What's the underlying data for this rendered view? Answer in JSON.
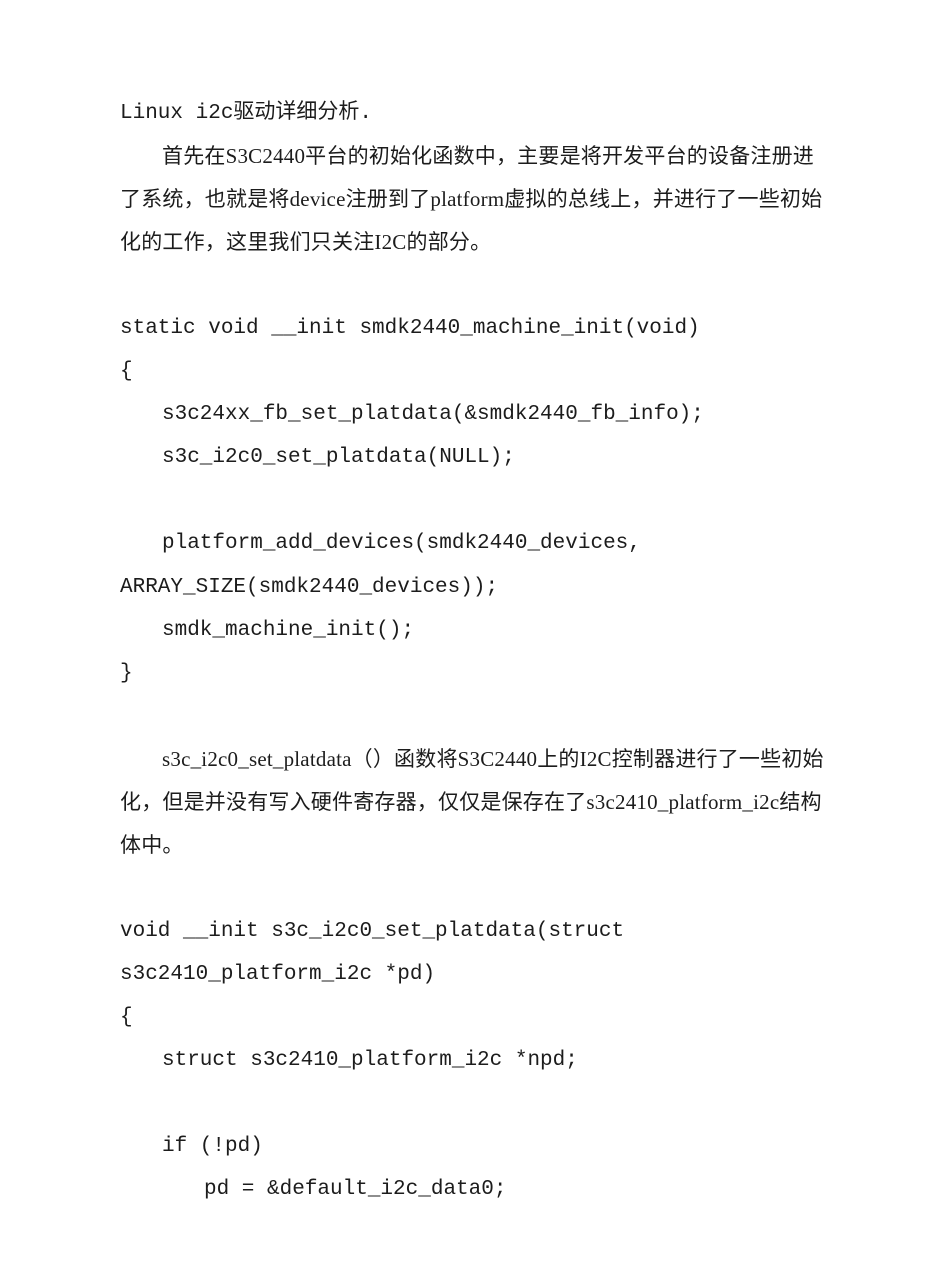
{
  "lines": [
    {
      "cls": "mono",
      "text": "Linux i2c驱动详细分析."
    },
    {
      "cls": "indent",
      "text": "首先在S3C2440平台的初始化函数中，主要是将开发平台的设备注册进了系统，也就是将device注册到了platform虚拟的总线上，并进行了一些初始化的工作，这里我们只关注I2C的部分。"
    },
    {
      "cls": "blank",
      "text": ""
    },
    {
      "cls": "mono",
      "text": "static void __init smdk2440_machine_init(void)"
    },
    {
      "cls": "mono",
      "text": "{"
    },
    {
      "cls": "mono code-indent-1",
      "text": "s3c24xx_fb_set_platdata(&smdk2440_fb_info);"
    },
    {
      "cls": "mono code-indent-1",
      "text": "s3c_i2c0_set_platdata(NULL);"
    },
    {
      "cls": "blank",
      "text": ""
    },
    {
      "cls": "mono code-indent-1",
      "text": "platform_add_devices(smdk2440_devices,"
    },
    {
      "cls": "mono",
      "text": "ARRAY_SIZE(smdk2440_devices));"
    },
    {
      "cls": "mono code-indent-1",
      "text": "smdk_machine_init();"
    },
    {
      "cls": "mono",
      "text": "}"
    },
    {
      "cls": "blank",
      "text": ""
    },
    {
      "cls": "indent",
      "text": "s3c_i2c0_set_platdata（）函数将S3C2440上的I2C控制器进行了一些初始化，但是并没有写入硬件寄存器，仅仅是保存在了s3c2410_platform_i2c结构体中。"
    },
    {
      "cls": "blank",
      "text": ""
    },
    {
      "cls": "mono",
      "text": "void __init s3c_i2c0_set_platdata(struct s3c2410_platform_i2c *pd)"
    },
    {
      "cls": "mono",
      "text": "{"
    },
    {
      "cls": "mono code-indent-1",
      "text": "struct s3c2410_platform_i2c *npd;"
    },
    {
      "cls": "blank",
      "text": ""
    },
    {
      "cls": "mono code-indent-1",
      "text": "if (!pd)"
    },
    {
      "cls": "mono code-indent-2",
      "text": "pd = &default_i2c_data0;"
    }
  ]
}
